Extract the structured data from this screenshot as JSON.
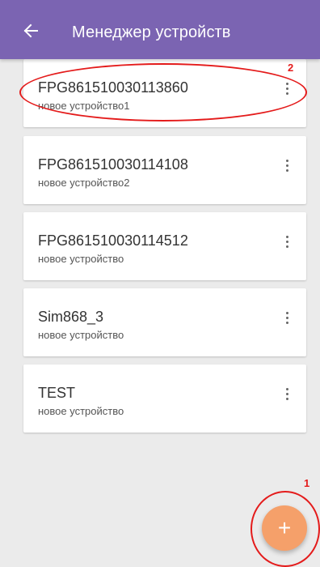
{
  "appbar": {
    "title": "Менеджер устройств",
    "back_icon": "arrow-left-icon",
    "color": "#7b64b2"
  },
  "devices": [
    {
      "name": "FPG861510030113860",
      "description": "новое устройство1"
    },
    {
      "name": "FPG861510030114108",
      "description": "новое устройство2"
    },
    {
      "name": "FPG861510030114512",
      "description": "новое устройство"
    },
    {
      "name": "Sim868_3",
      "description": "новое устройство"
    },
    {
      "name": "TEST",
      "description": "новое устройство"
    }
  ],
  "annotations": {
    "list_item_marker": "2",
    "fab_marker": "1",
    "color": "#e41b1b"
  },
  "fab": {
    "icon": "plus-icon",
    "label": "+",
    "color": "#f5a06a"
  }
}
